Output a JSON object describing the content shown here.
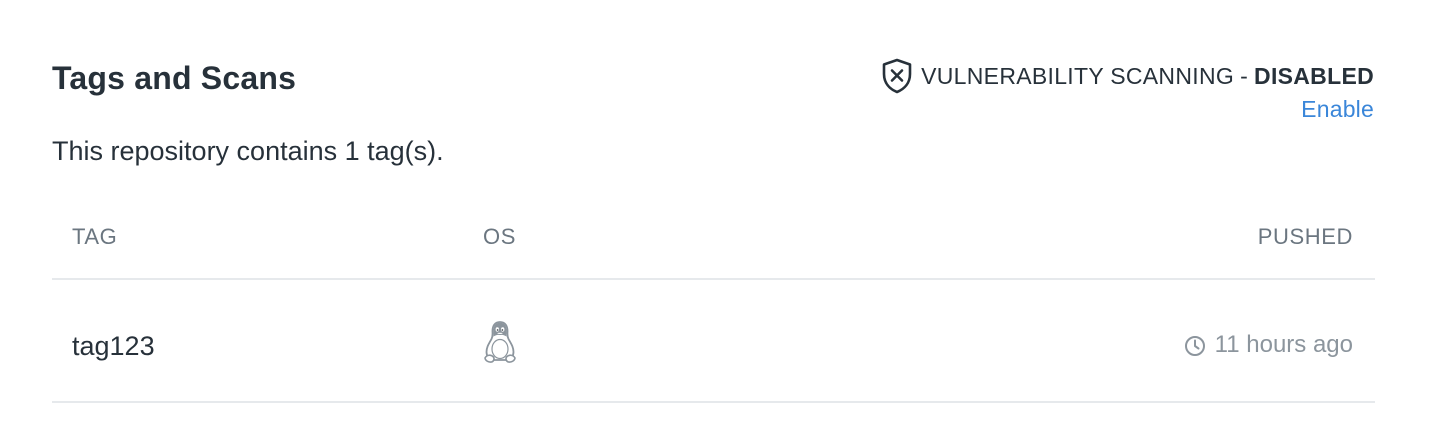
{
  "section": {
    "title": "Tags and Scans",
    "summary": "This repository contains 1 tag(s)."
  },
  "vulnerability": {
    "label": "VULNERABILITY SCANNING",
    "separator": "-",
    "state": "DISABLED",
    "icon": "shield-x-icon",
    "enable_label": "Enable",
    "link_color": "#3a86d9"
  },
  "table": {
    "columns": [
      "TAG",
      "OS",
      "PUSHED"
    ],
    "rows": [
      {
        "tag": "tag123",
        "os_icon": "linux-penguin-icon",
        "pushed": "11 hours ago",
        "pushed_icon": "clock-icon"
      }
    ]
  }
}
